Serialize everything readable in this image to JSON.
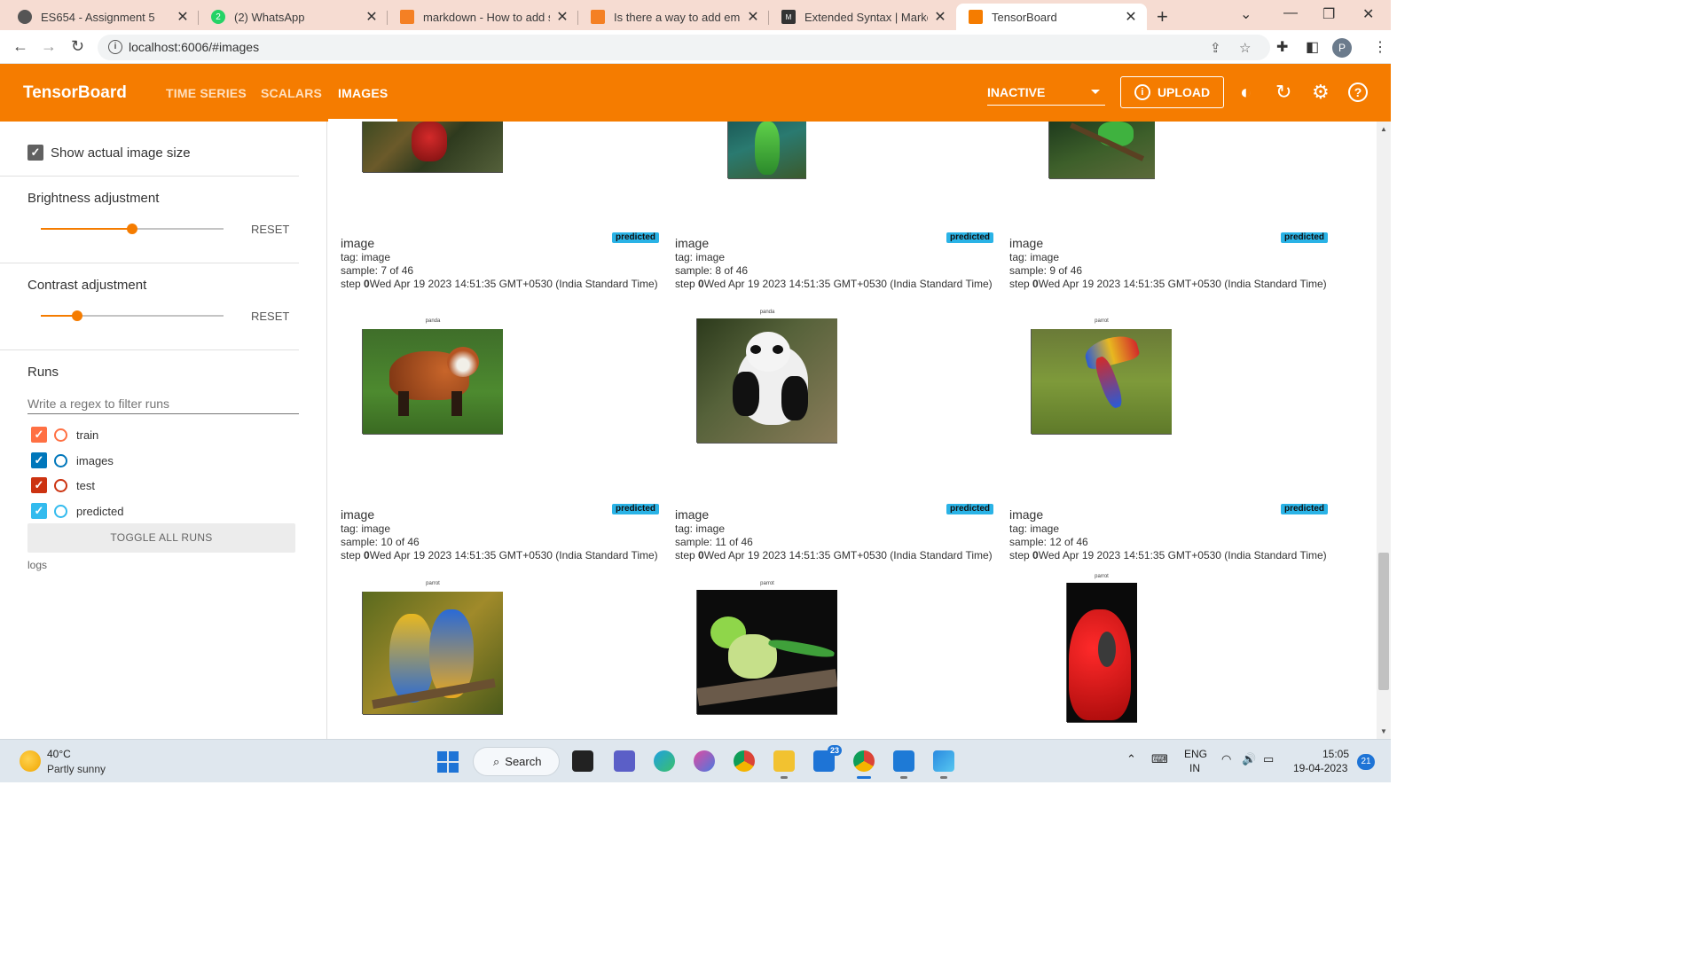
{
  "browser": {
    "tabs": [
      {
        "label": "ES654 - Assignment 5",
        "close": "✕",
        "favicon_color": "#555555"
      },
      {
        "label": "(2) WhatsApp",
        "close": "✕",
        "favicon_color": "#25d366"
      },
      {
        "label": "markdown - How to add sc",
        "close": "✕",
        "favicon_color": "#f48024"
      },
      {
        "label": "Is there a way to add embe",
        "close": "✕",
        "favicon_color": "#f48024"
      },
      {
        "label": "Extended Syntax | Markdow",
        "close": "✕",
        "favicon_color": "#333333"
      },
      {
        "label": "TensorBoard",
        "close": "✕",
        "favicon_color": "#f57c00"
      }
    ],
    "new_tab": "+",
    "url": "localhost:6006/#images",
    "profile_initial": "P"
  },
  "tensorboard": {
    "title": "TensorBoard",
    "nav": [
      "TIME SERIES",
      "SCALARS",
      "IMAGES"
    ],
    "active_nav": "IMAGES",
    "run_state": "INACTIVE",
    "upload_label": "UPLOAD",
    "accent": "#f57c00"
  },
  "sidebar": {
    "show_size_label": "Show actual image size",
    "brightness_label": "Brightness adjustment",
    "brightness_value": 0.5,
    "contrast_label": "Contrast adjustment",
    "contrast_value": 0.2,
    "reset_label": "RESET",
    "runs_label": "Runs",
    "filter_placeholder": "Write a regex to filter runs",
    "runs": [
      {
        "name": "train",
        "color": "#ff7043",
        "checked": true
      },
      {
        "name": "images",
        "color": "#0077bb",
        "checked": true
      },
      {
        "name": "test",
        "color": "#cc3311",
        "checked": true
      },
      {
        "name": "predicted",
        "color": "#33bbee",
        "checked": true
      }
    ],
    "toggle_all_label": "TOGGLE ALL RUNS",
    "logs_label": "logs"
  },
  "cards": [
    {
      "title": "image",
      "badge": "predicted",
      "tag": "tag: image",
      "sample": "sample: 7 of 46",
      "step_label": "step ",
      "step_value": "0",
      "time": "Wed Apr 19 2023 14:51:35 GMT+0530 (India Standard Time)"
    },
    {
      "title": "image",
      "badge": "predicted",
      "tag": "tag: image",
      "sample": "sample: 8 of 46",
      "step_label": "step ",
      "step_value": "0",
      "time": "Wed Apr 19 2023 14:51:35 GMT+0530 (India Standard Time)"
    },
    {
      "title": "image",
      "badge": "predicted",
      "tag": "tag: image",
      "sample": "sample: 9 of 46",
      "step_label": "step ",
      "step_value": "0",
      "time": "Wed Apr 19 2023 14:51:35 GMT+0530 (India Standard Time)"
    },
    {
      "title": "image",
      "badge": "predicted",
      "tag": "tag: image",
      "sample": "sample: 10 of 46",
      "step_label": "step ",
      "step_value": "0",
      "time": "Wed Apr 19 2023 14:51:35 GMT+0530 (India Standard Time)"
    },
    {
      "title": "image",
      "badge": "predicted",
      "tag": "tag: image",
      "sample": "sample: 11 of 46",
      "step_label": "step ",
      "step_value": "0",
      "time": "Wed Apr 19 2023 14:51:35 GMT+0530 (India Standard Time)"
    },
    {
      "title": "image",
      "badge": "predicted",
      "tag": "tag: image",
      "sample": "sample: 12 of 46",
      "step_label": "step ",
      "step_value": "0",
      "time": "Wed Apr 19 2023 14:51:35 GMT+0530 (India Standard Time)"
    }
  ],
  "plots": [
    {
      "subject": "red parrot (cropped, top row)"
    },
    {
      "subject": "green parrot (cropped, top row)"
    },
    {
      "subject": "green bird on branch (cropped, top row)"
    },
    {
      "subject": "red panda",
      "title": "panda"
    },
    {
      "subject": "giant panda",
      "title": "panda"
    },
    {
      "subject": "macaw in flight",
      "title": "parrot"
    },
    {
      "subject": "two macaws",
      "title": "parrot"
    },
    {
      "subject": "green parakeet",
      "title": "parrot"
    },
    {
      "subject": "red eclectus parrot",
      "title": "parrot"
    }
  ],
  "taskbar": {
    "temperature": "40°C",
    "weather": "Partly sunny",
    "search_label": "Search",
    "mail_badge": "23",
    "language_top": "ENG",
    "language_bottom": "IN",
    "time": "15:05",
    "date": "19-04-2023",
    "notifications": "21"
  }
}
